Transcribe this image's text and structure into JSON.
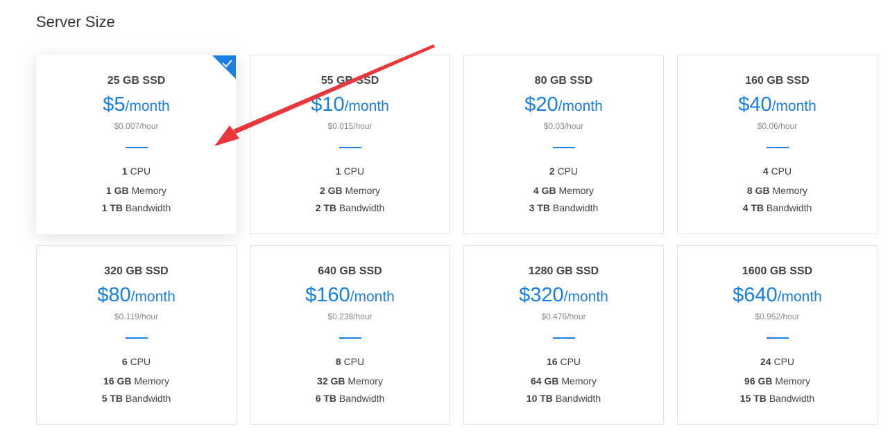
{
  "title": "Server Size",
  "colors": {
    "accent": "#1a7fe0",
    "annotation_arrow": "#e8383d"
  },
  "plans": [
    {
      "ssd": "25 GB SSD",
      "price": "$5",
      "per": "/month",
      "hourly": "$0.007/hour",
      "cpu": "1",
      "cpu_unit": "CPU",
      "memory": "1 GB",
      "memory_unit": "Memory",
      "bandwidth": "1 TB",
      "bandwidth_unit": "Bandwidth",
      "selected": true
    },
    {
      "ssd": "55 GB SSD",
      "price": "$10",
      "per": "/month",
      "hourly": "$0.015/hour",
      "cpu": "1",
      "cpu_unit": "CPU",
      "memory": "2 GB",
      "memory_unit": "Memory",
      "bandwidth": "2 TB",
      "bandwidth_unit": "Bandwidth",
      "selected": false
    },
    {
      "ssd": "80 GB SSD",
      "price": "$20",
      "per": "/month",
      "hourly": "$0.03/hour",
      "cpu": "2",
      "cpu_unit": "CPU",
      "memory": "4 GB",
      "memory_unit": "Memory",
      "bandwidth": "3 TB",
      "bandwidth_unit": "Bandwidth",
      "selected": false
    },
    {
      "ssd": "160 GB SSD",
      "price": "$40",
      "per": "/month",
      "hourly": "$0.06/hour",
      "cpu": "4",
      "cpu_unit": "CPU",
      "memory": "8 GB",
      "memory_unit": "Memory",
      "bandwidth": "4 TB",
      "bandwidth_unit": "Bandwidth",
      "selected": false
    },
    {
      "ssd": "320 GB SSD",
      "price": "$80",
      "per": "/month",
      "hourly": "$0.119/hour",
      "cpu": "6",
      "cpu_unit": "CPU",
      "memory": "16 GB",
      "memory_unit": "Memory",
      "bandwidth": "5 TB",
      "bandwidth_unit": "Bandwidth",
      "selected": false
    },
    {
      "ssd": "640 GB SSD",
      "price": "$160",
      "per": "/month",
      "hourly": "$0.238/hour",
      "cpu": "8",
      "cpu_unit": "CPU",
      "memory": "32 GB",
      "memory_unit": "Memory",
      "bandwidth": "6 TB",
      "bandwidth_unit": "Bandwidth",
      "selected": false
    },
    {
      "ssd": "1280 GB SSD",
      "price": "$320",
      "per": "/month",
      "hourly": "$0.476/hour",
      "cpu": "16",
      "cpu_unit": "CPU",
      "memory": "64 GB",
      "memory_unit": "Memory",
      "bandwidth": "10 TB",
      "bandwidth_unit": "Bandwidth",
      "selected": false
    },
    {
      "ssd": "1600 GB SSD",
      "price": "$640",
      "per": "/month",
      "hourly": "$0.952/hour",
      "cpu": "24",
      "cpu_unit": "CPU",
      "memory": "96 GB",
      "memory_unit": "Memory",
      "bandwidth": "15 TB",
      "bandwidth_unit": "Bandwidth",
      "selected": false
    }
  ]
}
